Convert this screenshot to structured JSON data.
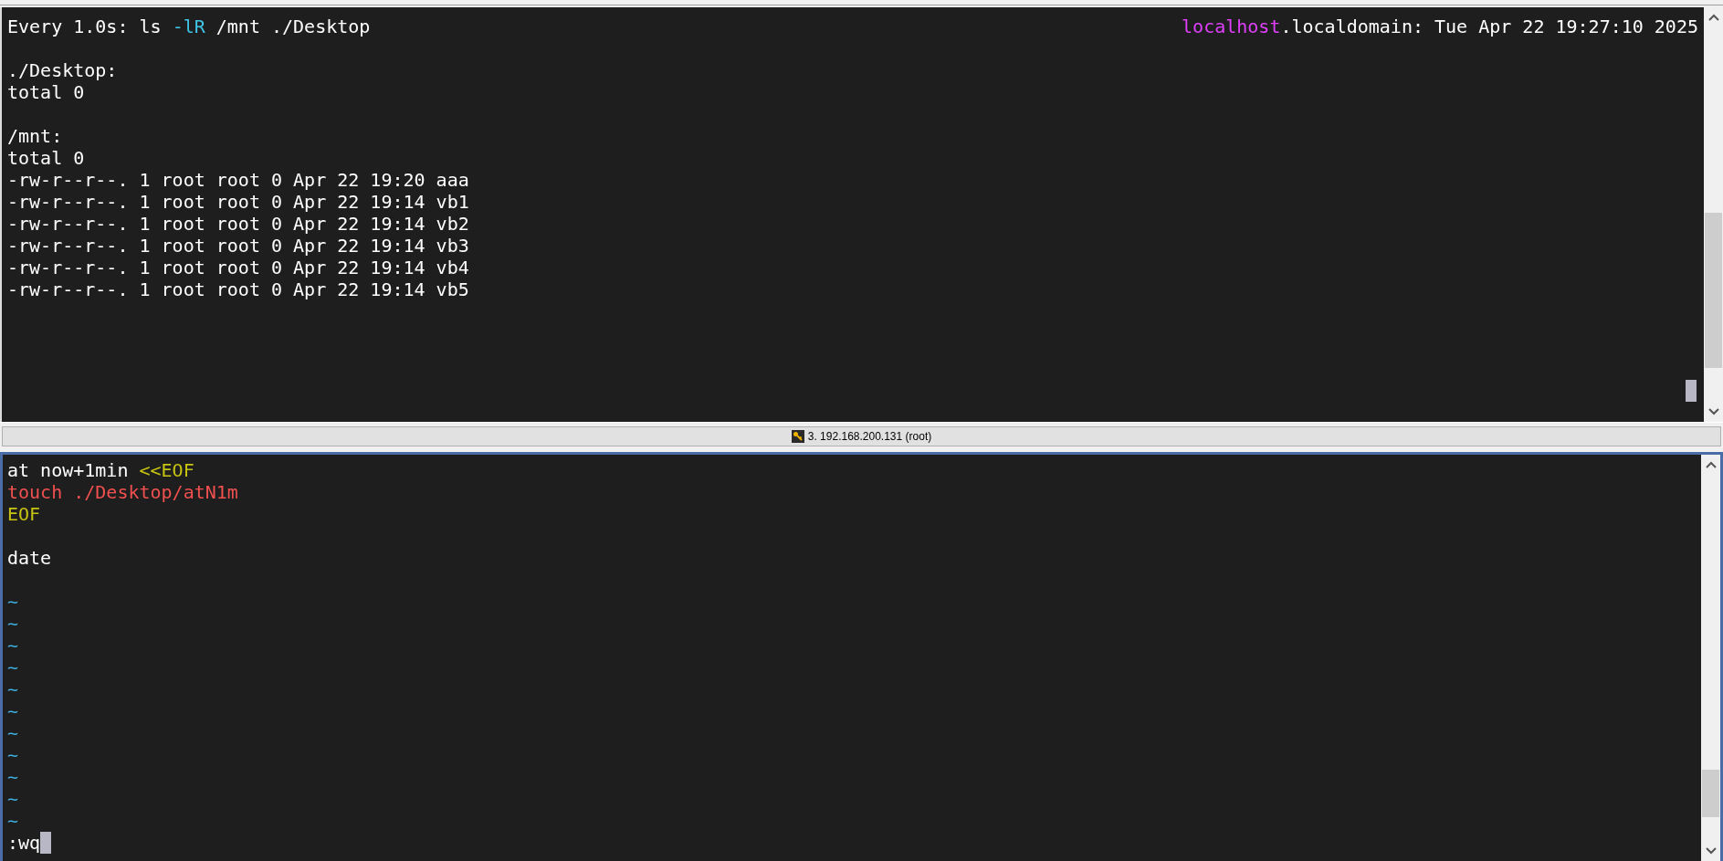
{
  "top_pane": {
    "header_left": [
      {
        "text": "Every 1.0s: ls ",
        "color": "#ffffff"
      },
      {
        "text": "-lR",
        "color": "#3fc5e8"
      },
      {
        "text": " /mnt ./Desktop",
        "color": "#ffffff"
      }
    ],
    "header_right": [
      {
        "text": "localhost",
        "color": "#e040fb"
      },
      {
        "text": ".localdomain: Tue Apr 22 19:27:10 2025",
        "color": "#ffffff"
      }
    ],
    "lines": [
      {
        "kind": "blank"
      },
      {
        "kind": "text",
        "segments": [
          {
            "text": "./Desktop:",
            "color": "#ffffff"
          }
        ]
      },
      {
        "kind": "text",
        "segments": [
          {
            "text": "total 0",
            "color": "#ffffff"
          }
        ]
      },
      {
        "kind": "blank"
      },
      {
        "kind": "text",
        "segments": [
          {
            "text": "/mnt:",
            "color": "#ffffff"
          }
        ]
      },
      {
        "kind": "text",
        "segments": [
          {
            "text": "total 0",
            "color": "#ffffff"
          }
        ]
      },
      {
        "kind": "text",
        "segments": [
          {
            "text": "-rw-r--r--. 1 root root 0 Apr 22 19:20 aaa",
            "color": "#ffffff"
          }
        ]
      },
      {
        "kind": "text",
        "segments": [
          {
            "text": "-rw-r--r--. 1 root root 0 Apr 22 19:14 vb1",
            "color": "#ffffff"
          }
        ]
      },
      {
        "kind": "text",
        "segments": [
          {
            "text": "-rw-r--r--. 1 root root 0 Apr 22 19:14 vb2",
            "color": "#ffffff"
          }
        ]
      },
      {
        "kind": "text",
        "segments": [
          {
            "text": "-rw-r--r--. 1 root root 0 Apr 22 19:14 vb3",
            "color": "#ffffff"
          }
        ]
      },
      {
        "kind": "text",
        "segments": [
          {
            "text": "-rw-r--r--. 1 root root 0 Apr 22 19:14 vb4",
            "color": "#ffffff"
          }
        ]
      },
      {
        "kind": "text",
        "segments": [
          {
            "text": "-rw-r--r--. 1 root root 0 Apr 22 19:14 vb5",
            "color": "#ffffff"
          }
        ]
      }
    ]
  },
  "status_bar": {
    "session": "3. 192.168.200.131 (root)"
  },
  "bottom_pane": {
    "lines": [
      {
        "kind": "text",
        "segments": [
          {
            "text": "at now+1min ",
            "color": "#ffffff"
          },
          {
            "text": "<<EOF",
            "color": "#c6c312"
          }
        ]
      },
      {
        "kind": "text",
        "segments": [
          {
            "text": "touch ./Desktop/atN1m",
            "color": "#f0504f"
          }
        ]
      },
      {
        "kind": "text",
        "segments": [
          {
            "text": "EOF",
            "color": "#c6c312"
          }
        ]
      },
      {
        "kind": "blank"
      },
      {
        "kind": "text",
        "segments": [
          {
            "text": "date",
            "color": "#ffffff"
          }
        ]
      },
      {
        "kind": "blank"
      },
      {
        "kind": "tilde",
        "segments": [
          {
            "text": "~",
            "color": "#3fb0e0"
          }
        ]
      },
      {
        "kind": "tilde",
        "segments": [
          {
            "text": "~",
            "color": "#3fb0e0"
          }
        ]
      },
      {
        "kind": "tilde",
        "segments": [
          {
            "text": "~",
            "color": "#3fb0e0"
          }
        ]
      },
      {
        "kind": "tilde",
        "segments": [
          {
            "text": "~",
            "color": "#3fb0e0"
          }
        ]
      },
      {
        "kind": "tilde",
        "segments": [
          {
            "text": "~",
            "color": "#3fb0e0"
          }
        ]
      },
      {
        "kind": "tilde",
        "segments": [
          {
            "text": "~",
            "color": "#3fb0e0"
          }
        ]
      },
      {
        "kind": "tilde",
        "segments": [
          {
            "text": "~",
            "color": "#3fb0e0"
          }
        ]
      },
      {
        "kind": "tilde",
        "segments": [
          {
            "text": "~",
            "color": "#3fb0e0"
          }
        ]
      },
      {
        "kind": "tilde",
        "segments": [
          {
            "text": "~",
            "color": "#3fb0e0"
          }
        ]
      },
      {
        "kind": "tilde",
        "segments": [
          {
            "text": "~",
            "color": "#3fb0e0"
          }
        ]
      },
      {
        "kind": "tilde",
        "segments": [
          {
            "text": "~",
            "color": "#3fb0e0"
          }
        ]
      }
    ],
    "command_line": {
      "text": ":wq",
      "cursor": true
    }
  }
}
